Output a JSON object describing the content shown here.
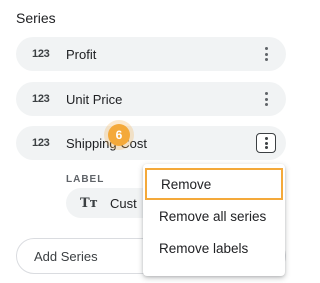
{
  "section": {
    "title": "Series"
  },
  "series": [
    {
      "type": "123",
      "label": "Profit"
    },
    {
      "type": "123",
      "label": "Unit Price"
    },
    {
      "type": "123",
      "label": "Shipping Cost"
    }
  ],
  "sub": {
    "label_heading": "LABEL",
    "chip_icon": "Tт",
    "chip_label": "Cust"
  },
  "step_badge": "6",
  "add_series": {
    "label": "Add Series"
  },
  "menu": {
    "items": [
      "Remove",
      "Remove all series",
      "Remove labels"
    ]
  },
  "colors": {
    "accent": "#f4a93a",
    "chip_bg": "#f1f3f4"
  }
}
